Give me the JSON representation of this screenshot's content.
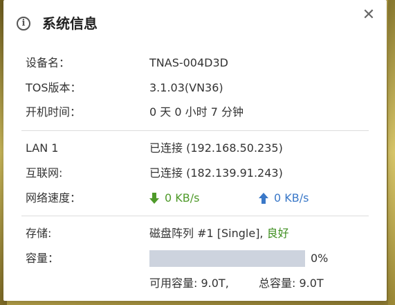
{
  "dialog": {
    "title": "系统信息",
    "info_icon": "info-icon",
    "close_icon": "close-icon",
    "close_glyph": "✕"
  },
  "device": {
    "name_label": "设备名：",
    "name_value": "TNAS-004D3D",
    "tos_label": "TOS版本：",
    "tos_value": "3.1.03(VN36)",
    "uptime_label": "开机时间：",
    "uptime_value": "0 天 0 小时 7 分钟"
  },
  "network": {
    "lan_label": "LAN 1",
    "lan_value": "已连接 (192.168.50.235)",
    "internet_label": "互联网:",
    "internet_value": "已连接 (182.139.91.243)",
    "speed_label": "网络速度：",
    "download_speed": "0 KB/s",
    "upload_speed": "0 KB/s",
    "download_color": "#4f9a2a",
    "upload_color": "#3a78c8"
  },
  "storage": {
    "storage_label": "存储:",
    "storage_value": "磁盘阵列 #1 [Single],",
    "storage_status": "良好",
    "status_color": "#3f8f20",
    "capacity_label": "容量：",
    "capacity_used_fraction": 0,
    "capacity_percent": "0%",
    "available": "可用容量: 9.0T,",
    "total": "总容量: 9.0T"
  }
}
